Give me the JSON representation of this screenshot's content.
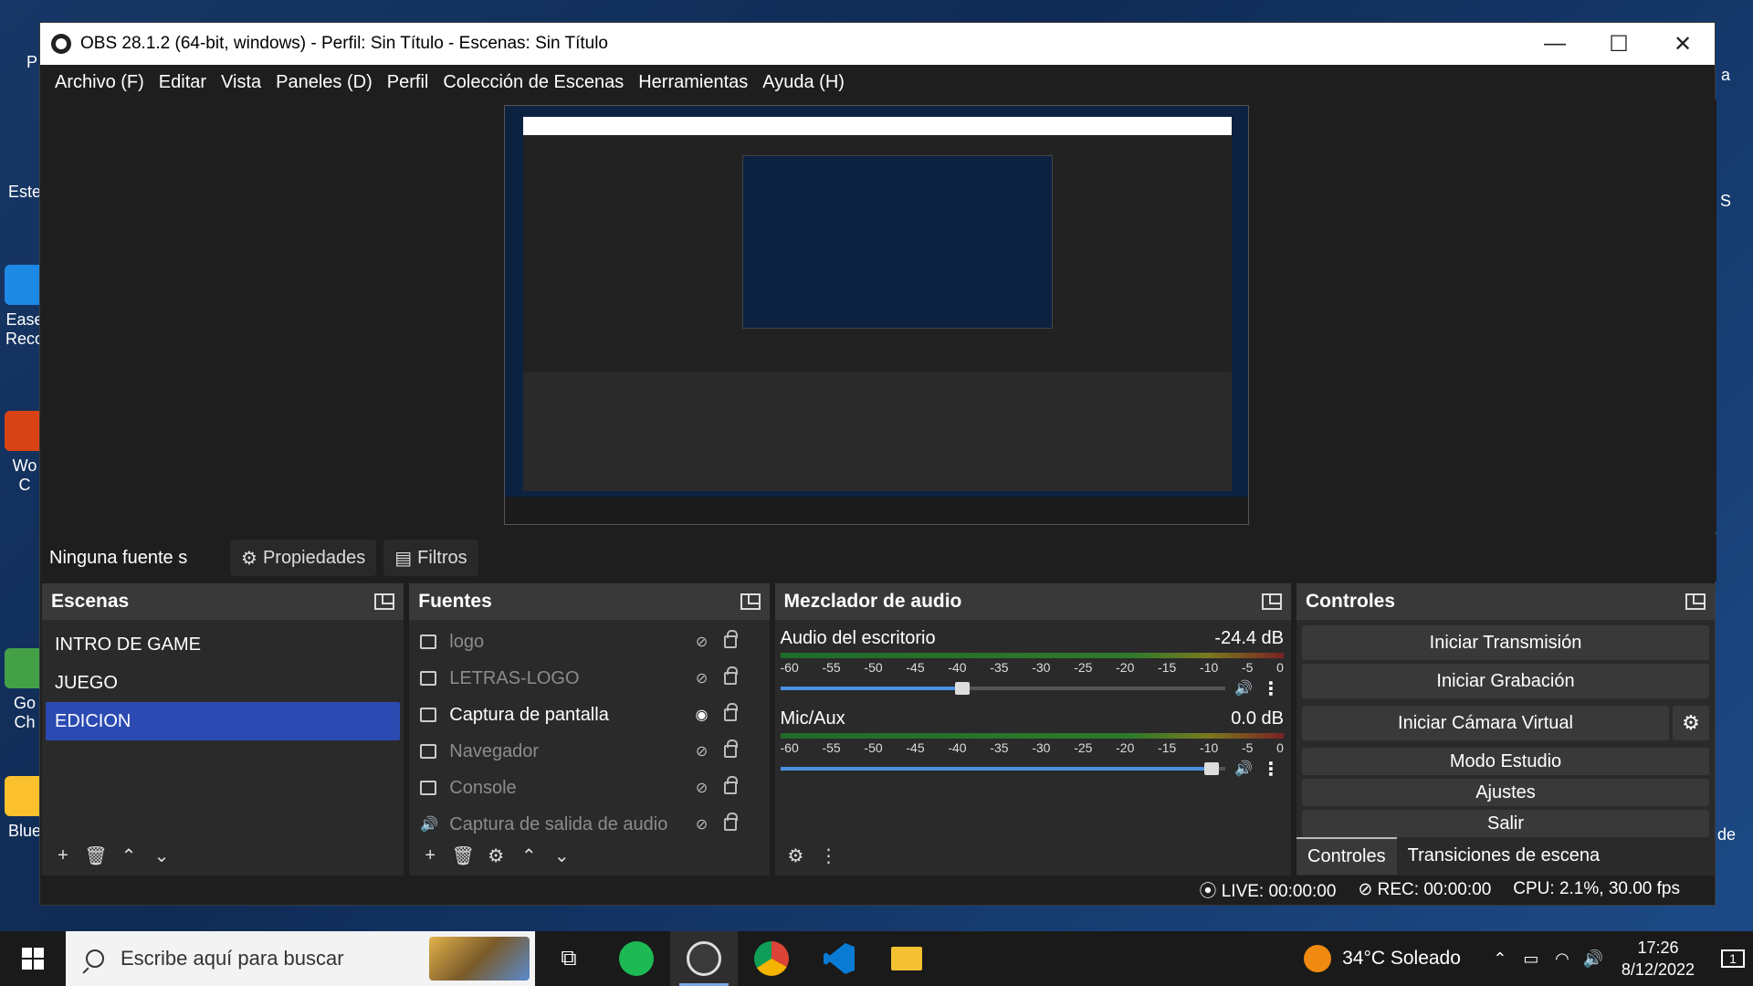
{
  "window": {
    "title": "OBS 28.1.2 (64-bit, windows) - Perfil: Sin Título - Escenas: Sin Título",
    "minimize": "—",
    "maximize": "☐",
    "close": "✕"
  },
  "menu": [
    "Archivo (F)",
    "Editar",
    "Vista",
    "Paneles (D)",
    "Perfil",
    "Colección de Escenas",
    "Herramientas",
    "Ayuda (H)"
  ],
  "source_toolbar": {
    "no_source": "Ninguna fuente s",
    "properties": "Propiedades",
    "filters": "Filtros"
  },
  "scenes": {
    "title": "Escenas",
    "items": [
      "INTRO DE GAME",
      "JUEGO",
      "EDICION"
    ],
    "selected": "EDICION"
  },
  "sources": {
    "title": "Fuentes",
    "items": [
      {
        "name": "logo",
        "visible": false
      },
      {
        "name": "LETRAS-LOGO",
        "visible": false
      },
      {
        "name": "Captura de pantalla",
        "visible": true
      },
      {
        "name": "Navegador",
        "visible": false
      },
      {
        "name": "Console",
        "visible": false
      },
      {
        "name": "Captura de salida de audio",
        "visible": false
      }
    ]
  },
  "mixer": {
    "title": "Mezclador de audio",
    "ticks": [
      "-60",
      "-55",
      "-50",
      "-45",
      "-40",
      "-35",
      "-30",
      "-25",
      "-20",
      "-15",
      "-10",
      "-5",
      "0"
    ],
    "channels": [
      {
        "name": "Audio del escritorio",
        "level": "-24.4 dB",
        "fader_fraction": 0.41
      },
      {
        "name": "Mic/Aux",
        "level": "0.0 dB",
        "fader_fraction": 0.97
      }
    ]
  },
  "controls": {
    "title": "Controles",
    "start_stream": "Iniciar Transmisión",
    "start_record": "Iniciar Grabación",
    "start_vcam": "Iniciar Cámara Virtual",
    "studio_mode": "Modo Estudio",
    "settings": "Ajustes",
    "exit": "Salir",
    "tab_controls": "Controles",
    "tab_transitions": "Transiciones de escena"
  },
  "status": {
    "live": "LIVE: 00:00:00",
    "rec": "REC: 00:00:00",
    "cpu": "CPU: 2.1%, 30.00 fps"
  },
  "desktop_labels": [
    "P",
    "Este",
    "Ease",
    "Reco",
    "Wo",
    "C",
    "Go",
    "Ch",
    "Blue",
    "a",
    "S",
    "de"
  ],
  "taskbar": {
    "search_placeholder": "Escribe aquí para buscar",
    "weather": "34°C  Soleado",
    "time": "17:26",
    "date": "8/12/2022",
    "notif_count": "1"
  },
  "colors": {
    "accent": "#2b4ab2",
    "window_bg": "#1f1e1f",
    "dock_bg": "#2b2a2b"
  }
}
